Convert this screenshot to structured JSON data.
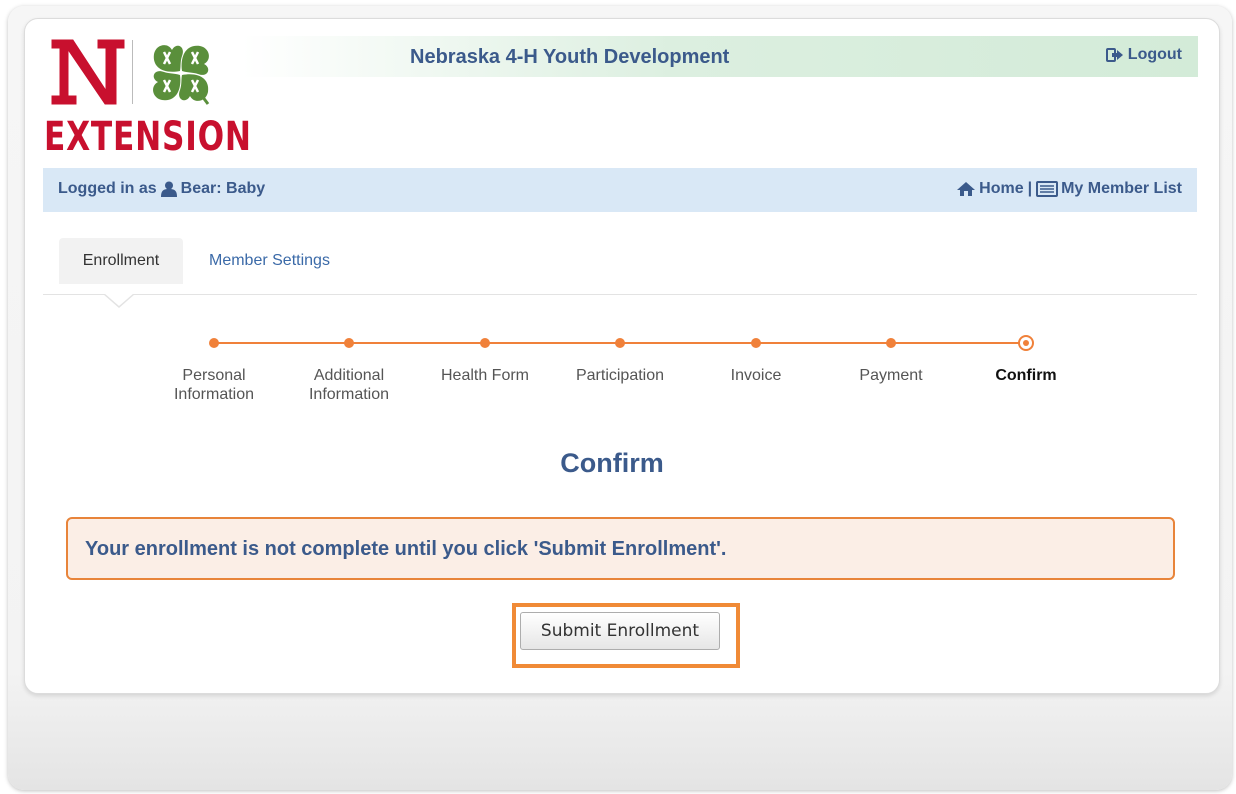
{
  "logo": {
    "monogram": "N",
    "text": "EXTENSION",
    "brand_red": "#c8102e",
    "clover_green": "#5a8f3b"
  },
  "header": {
    "title": "Nebraska 4-H Youth Development",
    "logout_label": "Logout",
    "logout_icon": "sign-out-icon"
  },
  "login_bar": {
    "prefix": "Logged in as",
    "user_icon": "user-icon",
    "user_name": "Bear: Baby",
    "home_label": "Home",
    "separator": "|",
    "member_list_label": "My Member List"
  },
  "tabs": [
    {
      "label": "Enrollment",
      "active": true
    },
    {
      "label": "Member Settings",
      "active": false
    }
  ],
  "stepper": {
    "accent": "#f0813a",
    "steps": [
      {
        "label_line1": "Personal",
        "label_line2": "Information"
      },
      {
        "label_line1": "Additional",
        "label_line2": "Information"
      },
      {
        "label_line1": "Health Form",
        "label_line2": ""
      },
      {
        "label_line1": "Participation",
        "label_line2": ""
      },
      {
        "label_line1": "Invoice",
        "label_line2": ""
      },
      {
        "label_line1": "Payment",
        "label_line2": ""
      },
      {
        "label_line1": "Confirm",
        "label_line2": ""
      }
    ],
    "current_step": "Confirm"
  },
  "main": {
    "heading": "Confirm",
    "notice": "Your enrollment is not complete until you click 'Submit Enrollment'.",
    "submit_label": "Submit Enrollment",
    "highlight_color": "#f08a36"
  }
}
